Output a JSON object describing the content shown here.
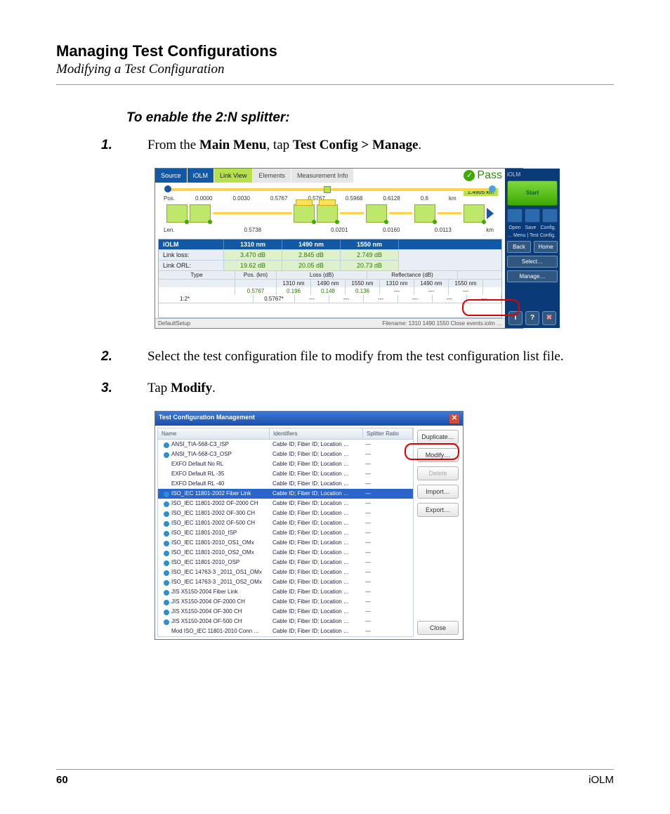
{
  "header": {
    "title": "Managing Test Configurations",
    "subtitle": "Modifying a Test Configuration"
  },
  "intro_heading": "To enable the 2:N splitter:",
  "step1": {
    "num": "1.",
    "pre": "From the ",
    "b1": "Main Menu",
    "mid": ", tap ",
    "b2": "Test Config > Manage",
    "post": "."
  },
  "step2": {
    "num": "2.",
    "text": "Select the test configuration file to modify from the test configuration list file."
  },
  "step3": {
    "num": "3.",
    "pre": "Tap ",
    "b": "Modify",
    "post": "."
  },
  "shot1": {
    "tabs": [
      "Source",
      "iOLM",
      "Link View",
      "Elements",
      "Measurement Info"
    ],
    "active_tab": 2,
    "pass": "Pass",
    "distance": "1.4905 km",
    "pos_label": "Pos.",
    "len_label": "Len.",
    "positions": [
      "0.0000",
      "0.0030",
      "0.5767",
      "0.5767",
      "0.5968",
      "0.6128",
      "0.6"
    ],
    "pos_unit": "km",
    "splitter_label": "1:2",
    "lengths": [
      "0.5738",
      "0.0201",
      "0.0160",
      "0.0113"
    ],
    "len_unit": "km",
    "results": {
      "hdr": [
        "iOLM",
        "1310 nm",
        "1490 nm",
        "1550 nm"
      ],
      "rows": [
        {
          "label": "Link loss:",
          "v": [
            "3.470 dB",
            "2.845 dB",
            "2.749 dB"
          ]
        },
        {
          "label": "Link ORL:",
          "v": [
            "19.62 dB",
            "20.05 dB",
            "20.73 dB"
          ]
        }
      ]
    },
    "events": {
      "group_hdr": [
        "Type",
        "Pos. (km)",
        "Loss (dB)",
        "Reflectance (dB)"
      ],
      "sub_hdr": [
        "1310 nm",
        "1490 nm",
        "1550 nm",
        "1310 nm",
        "1490 nm",
        "1550 nm"
      ],
      "rows": [
        {
          "type": "",
          "pos": "0.5767",
          "loss": [
            "0.196",
            "0.148",
            "0.136"
          ],
          "refl": [
            "---",
            "---",
            "---"
          ]
        },
        {
          "type": "1:2*",
          "pos": "0.5767*",
          "loss": [
            "---",
            "---",
            "---"
          ],
          "refl": [
            "---",
            "---",
            "---"
          ]
        }
      ]
    },
    "status_left": "DefaultSetup",
    "status_right": "Filename: 1310 1490 1550 Close events.iolm …",
    "side": {
      "app": "iOLM",
      "start": "Start",
      "icon_labels": [
        "Open",
        "Save",
        "Config."
      ],
      "breadcrumb": "… Menu | Test Config.",
      "back": "Back",
      "home": "Home",
      "select": "Select…",
      "manage": "Manage…",
      "bottom_icons": [
        "i",
        "?",
        "✖"
      ]
    }
  },
  "shot2": {
    "title": "Test Configuration Management",
    "columns": [
      "Name",
      "Identifiers",
      "Splitter Ratio"
    ],
    "ident": "Cable ID; Fiber ID; Location …",
    "ratio": "---",
    "rows": [
      {
        "n": "ANSI_TIA-568-C3_ISP",
        "b": true
      },
      {
        "n": "ANSI_TIA-568-C3_OSP",
        "b": true
      },
      {
        "n": "EXFO Default No RL",
        "b": false
      },
      {
        "n": "EXFO Default RL -35",
        "b": false
      },
      {
        "n": "EXFO Default RL -40",
        "b": false
      },
      {
        "n": "ISO_IEC 11801-2002 Fiber Link",
        "b": true,
        "sel": true
      },
      {
        "n": "ISO_IEC 11801-2002 OF-2000 CH",
        "b": true
      },
      {
        "n": "ISO_IEC 11801-2002 OF-300 CH",
        "b": true
      },
      {
        "n": "ISO_IEC 11801-2002 OF-500 CH",
        "b": true
      },
      {
        "n": "ISO_IEC 11801-2010_ISP",
        "b": true
      },
      {
        "n": "ISO_IEC 11801-2010_OS1_OMx",
        "b": true
      },
      {
        "n": "ISO_IEC 11801-2010_OS2_OMx",
        "b": true
      },
      {
        "n": "ISO_IEC 11801-2010_OSP",
        "b": true
      },
      {
        "n": "ISO_IEC 14763-3 _2011_OS1_OMx",
        "b": true
      },
      {
        "n": "ISO_IEC 14763-3 _2011_OS2_OMx",
        "b": true
      },
      {
        "n": "JIS X5150-2004 Fiber Link",
        "b": true
      },
      {
        "n": "JIS X5150-2004 OF-2000 CH",
        "b": true
      },
      {
        "n": "JIS X5150-2004 OF-300 CH",
        "b": true
      },
      {
        "n": "JIS X5150-2004 OF-500 CH",
        "b": true
      },
      {
        "n": "Mod ISO_IEC 11801-2010 Conn …",
        "b": false
      }
    ],
    "buttons": {
      "dup": "Duplicate…",
      "mod": "Modify…",
      "del": "Delete",
      "imp": "Import…",
      "exp": "Export…",
      "close": "Close"
    }
  },
  "footer": {
    "page": "60",
    "product": "iOLM"
  }
}
